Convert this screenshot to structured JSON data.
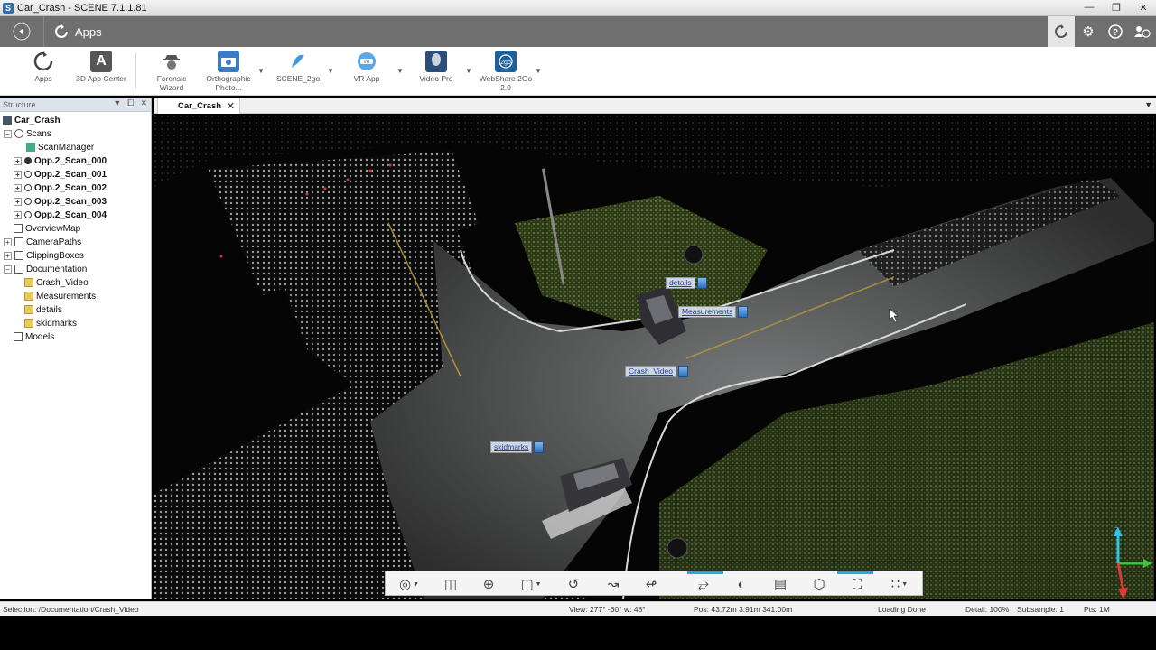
{
  "window": {
    "title": "Car_Crash - SCENE 7.1.1.81"
  },
  "nav": {
    "breadcrumb": "Apps"
  },
  "ribbon": {
    "items": [
      {
        "label": "Apps"
      },
      {
        "label": "3D App Center"
      },
      {
        "label": "Forensic Wizard"
      },
      {
        "label": "Orthographic Photo..."
      },
      {
        "label": "SCENE_2go"
      },
      {
        "label": "VR App"
      },
      {
        "label": "Video Pro"
      },
      {
        "label": "WebShare 2Go 2.0"
      }
    ]
  },
  "structure": {
    "header": "Structure",
    "nodes": [
      {
        "label": "Car_Crash"
      },
      {
        "label": "Scans"
      },
      {
        "label": "ScanManager"
      },
      {
        "label": "Opp.2_Scan_000"
      },
      {
        "label": "Opp.2_Scan_001"
      },
      {
        "label": "Opp.2_Scan_002"
      },
      {
        "label": "Opp.2_Scan_003"
      },
      {
        "label": "Opp.2_Scan_004"
      },
      {
        "label": "OverviewMap"
      },
      {
        "label": "CameraPaths"
      },
      {
        "label": "ClippingBoxes"
      },
      {
        "label": "Documentation"
      },
      {
        "label": "Crash_Video"
      },
      {
        "label": "Measurements"
      },
      {
        "label": "details"
      },
      {
        "label": "skidmarks"
      },
      {
        "label": "Models"
      }
    ]
  },
  "tabs": {
    "active": "Car_Crash"
  },
  "viewport": {
    "tags": [
      {
        "label": "details"
      },
      {
        "label": "Measurements"
      },
      {
        "label": "Crash_Video"
      },
      {
        "label": "skidmarks"
      }
    ],
    "gizmo_z": "Z"
  },
  "status": {
    "selection": "Selection: /Documentation/Crash_Video",
    "view": "View: 277° -60° w: 48°",
    "pos": "Pos: 43.72m 3.91m 341.00m",
    "loading": "Loading Done",
    "detail": "Detail: 100%",
    "subsample": "Subsample: 1",
    "pts": "Pts: 1M"
  },
  "colors": {
    "nav_bg": "#6f6f6f",
    "accent": "#29a8e0",
    "tag_text": "#1f3fa0"
  }
}
